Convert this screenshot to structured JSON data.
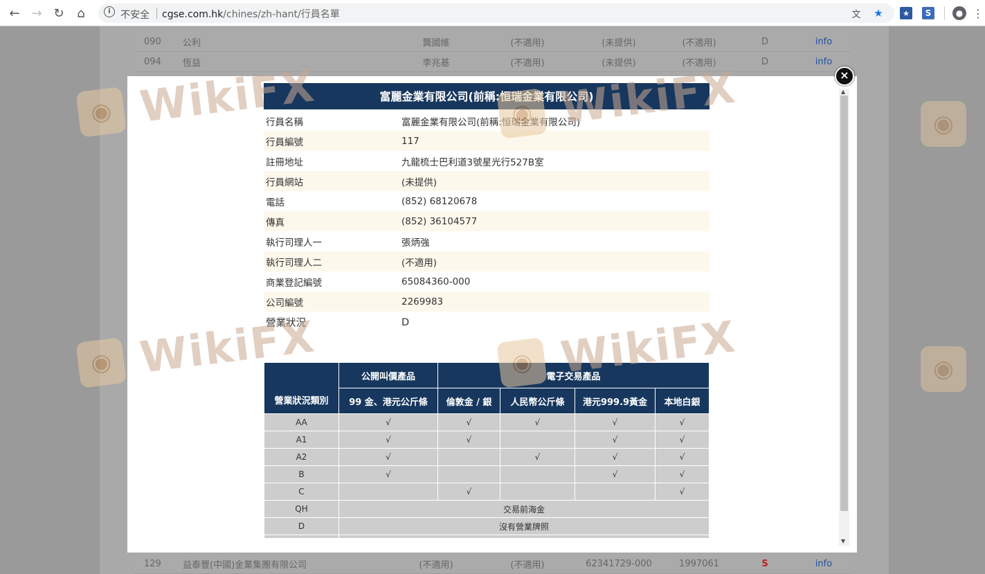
{
  "browser": {
    "insecure_label": "不安全",
    "url_host": "cgse.com.hk",
    "url_path": "/chines/zh-hant/行員名單"
  },
  "background_rows": [
    {
      "code": "090",
      "name": "公利",
      "person": "龔國維",
      "c1": "(不適用)",
      "c2": "(未提供)",
      "c3": "(不適用)",
      "status": "D",
      "link": "info"
    },
    {
      "code": "094",
      "name": "恆益",
      "person": "李兆基",
      "c1": "(不適用)",
      "c2": "(未提供)",
      "c3": "(不適用)",
      "status": "D",
      "link": "info"
    },
    {
      "code": "129",
      "name": "益泰豐(中國)金業集團有限公司",
      "person": "(不適用)",
      "c1": "(不適用)",
      "c2": "62341729-000",
      "c3": "1997061",
      "status": "S",
      "link": "info"
    }
  ],
  "modal": {
    "title": "富麗金業有限公司(前稱:恒瑞金業有限公司)",
    "close_glyph": "×",
    "details": [
      {
        "label": "行員名稱",
        "value": "富麗金業有限公司(前稱:恒瑞金業有限公司)"
      },
      {
        "label": "行員編號",
        "value": "117"
      },
      {
        "label": "註冊地址",
        "value": "九龍梳士巴利道3號星光行527B室"
      },
      {
        "label": "行員網站",
        "value": "(未提供)"
      },
      {
        "label": "電話",
        "value": "(852) 68120678"
      },
      {
        "label": "傳真",
        "value": "(852) 36104577"
      },
      {
        "label": "執行司理人一",
        "value": "張炳強"
      },
      {
        "label": "執行司理人二",
        "value": "(不適用)"
      },
      {
        "label": "商業登記編號",
        "value": "65084360-000"
      },
      {
        "label": "公司編號",
        "value": "2269983"
      },
      {
        "label": "營業狀況",
        "value": "D"
      }
    ],
    "status_table": {
      "row_header": "營業狀況類別",
      "group_public": "公開叫價產品",
      "group_electronic": "電子交易產品",
      "columns": [
        "99 金、港元公斤條",
        "倫敦金 / 銀",
        "人民幣公斤條",
        "港元999.9黃金",
        "本地白銀"
      ],
      "rows": [
        {
          "cat": "AA",
          "cells": [
            "√",
            "√",
            "√",
            "√",
            "√"
          ]
        },
        {
          "cat": "A1",
          "cells": [
            "√",
            "√",
            "",
            "√",
            "√"
          ]
        },
        {
          "cat": "A2",
          "cells": [
            "√",
            "",
            "√",
            "√",
            "√"
          ]
        },
        {
          "cat": "B",
          "cells": [
            "√",
            "",
            "",
            "√",
            "√"
          ]
        },
        {
          "cat": "C",
          "cells": [
            "",
            "√",
            "",
            "",
            "√"
          ]
        }
      ],
      "span_rows": [
        {
          "cat": "QH",
          "text": "交易前海金"
        },
        {
          "cat": "D",
          "text": "沒有營業牌照"
        }
      ]
    }
  },
  "watermark": {
    "text": "WikiFX"
  }
}
